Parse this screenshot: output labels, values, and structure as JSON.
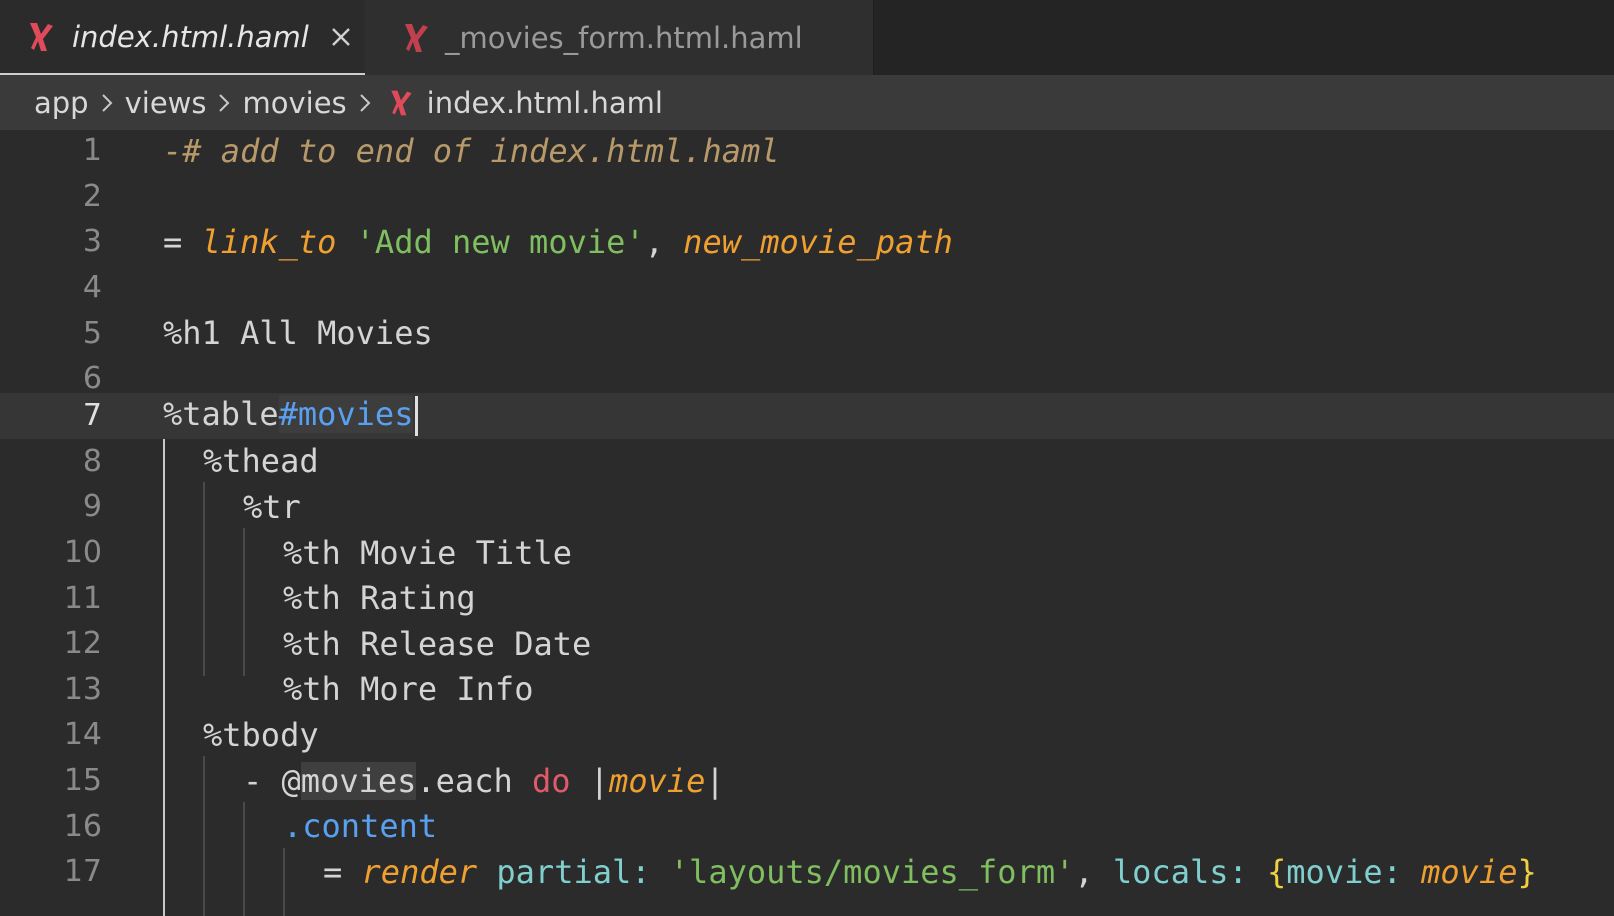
{
  "tabs": [
    {
      "label": "index.html.haml",
      "active": true,
      "close_glyph": "✕"
    },
    {
      "label": "_movies_form.html.haml",
      "active": false
    }
  ],
  "breadcrumb": [
    "app",
    "views",
    "movies",
    "index.html.haml"
  ],
  "icons": {
    "file": "haml-file-icon",
    "close": "close-icon",
    "separator": "chevron-right-icon"
  },
  "colors": {
    "accent_icon": "#e04a5a",
    "string": "#7fbf5f",
    "function": "#f0a030",
    "comment": "#b89a6a",
    "selector": "#5aa0f0"
  },
  "editor": {
    "current_line": 7,
    "lines": [
      {
        "n": "1",
        "text": "-# add to end of index.html.haml"
      },
      {
        "n": "2",
        "text": ""
      },
      {
        "n": "3",
        "text": "= link_to 'Add new movie', new_movie_path"
      },
      {
        "n": "4",
        "text": ""
      },
      {
        "n": "5",
        "text": "%h1 All Movies"
      },
      {
        "n": "6",
        "text": ""
      },
      {
        "n": "7",
        "text": "%table#movies"
      },
      {
        "n": "8",
        "text": "  %thead"
      },
      {
        "n": "9",
        "text": "    %tr"
      },
      {
        "n": "10",
        "text": "      %th Movie Title"
      },
      {
        "n": "11",
        "text": "      %th Rating"
      },
      {
        "n": "12",
        "text": "      %th Release Date"
      },
      {
        "n": "13",
        "text": "      %th More Info"
      },
      {
        "n": "14",
        "text": "  %tbody"
      },
      {
        "n": "15",
        "text": "    - @movies.each do |movie|"
      },
      {
        "n": "16",
        "text": "      .content"
      },
      {
        "n": "17",
        "text": "        = render partial: 'layouts/movies_form', locals: {movie: movie}"
      }
    ]
  },
  "tokens": {
    "l1_comment": "-# add to end of index.html.haml",
    "l3_eq": "= ",
    "l3_fn": "link_to",
    "l3_str": "'Add new movie'",
    "l3_comma": ", ",
    "l3_path": "new_movie_path",
    "l5": "%h1 All Movies",
    "l7_tag": "%table",
    "l7_id": "#movies",
    "l8": "%thead",
    "l9": "%tr",
    "l10": "%th Movie Title",
    "l11": "%th Rating",
    "l12": "%th Release Date",
    "l13": "%th More Info",
    "l14": "%tbody",
    "l15_dash": "- @",
    "l15_ivar": "movies",
    "l15_each": ".each ",
    "l15_do": "do",
    "l15_pipe1": " |",
    "l15_param": "movie",
    "l15_pipe2": "|",
    "l16": ".content",
    "l17_eq": "= ",
    "l17_render": "render",
    "l17_partial": " partial:",
    "l17_str": " 'layouts/movies_form'",
    "l17_comma": ", ",
    "l17_locals": "locals:",
    "l17_b1": " {",
    "l17_key": "movie:",
    "l17_val": " movie",
    "l17_b2": "}"
  }
}
